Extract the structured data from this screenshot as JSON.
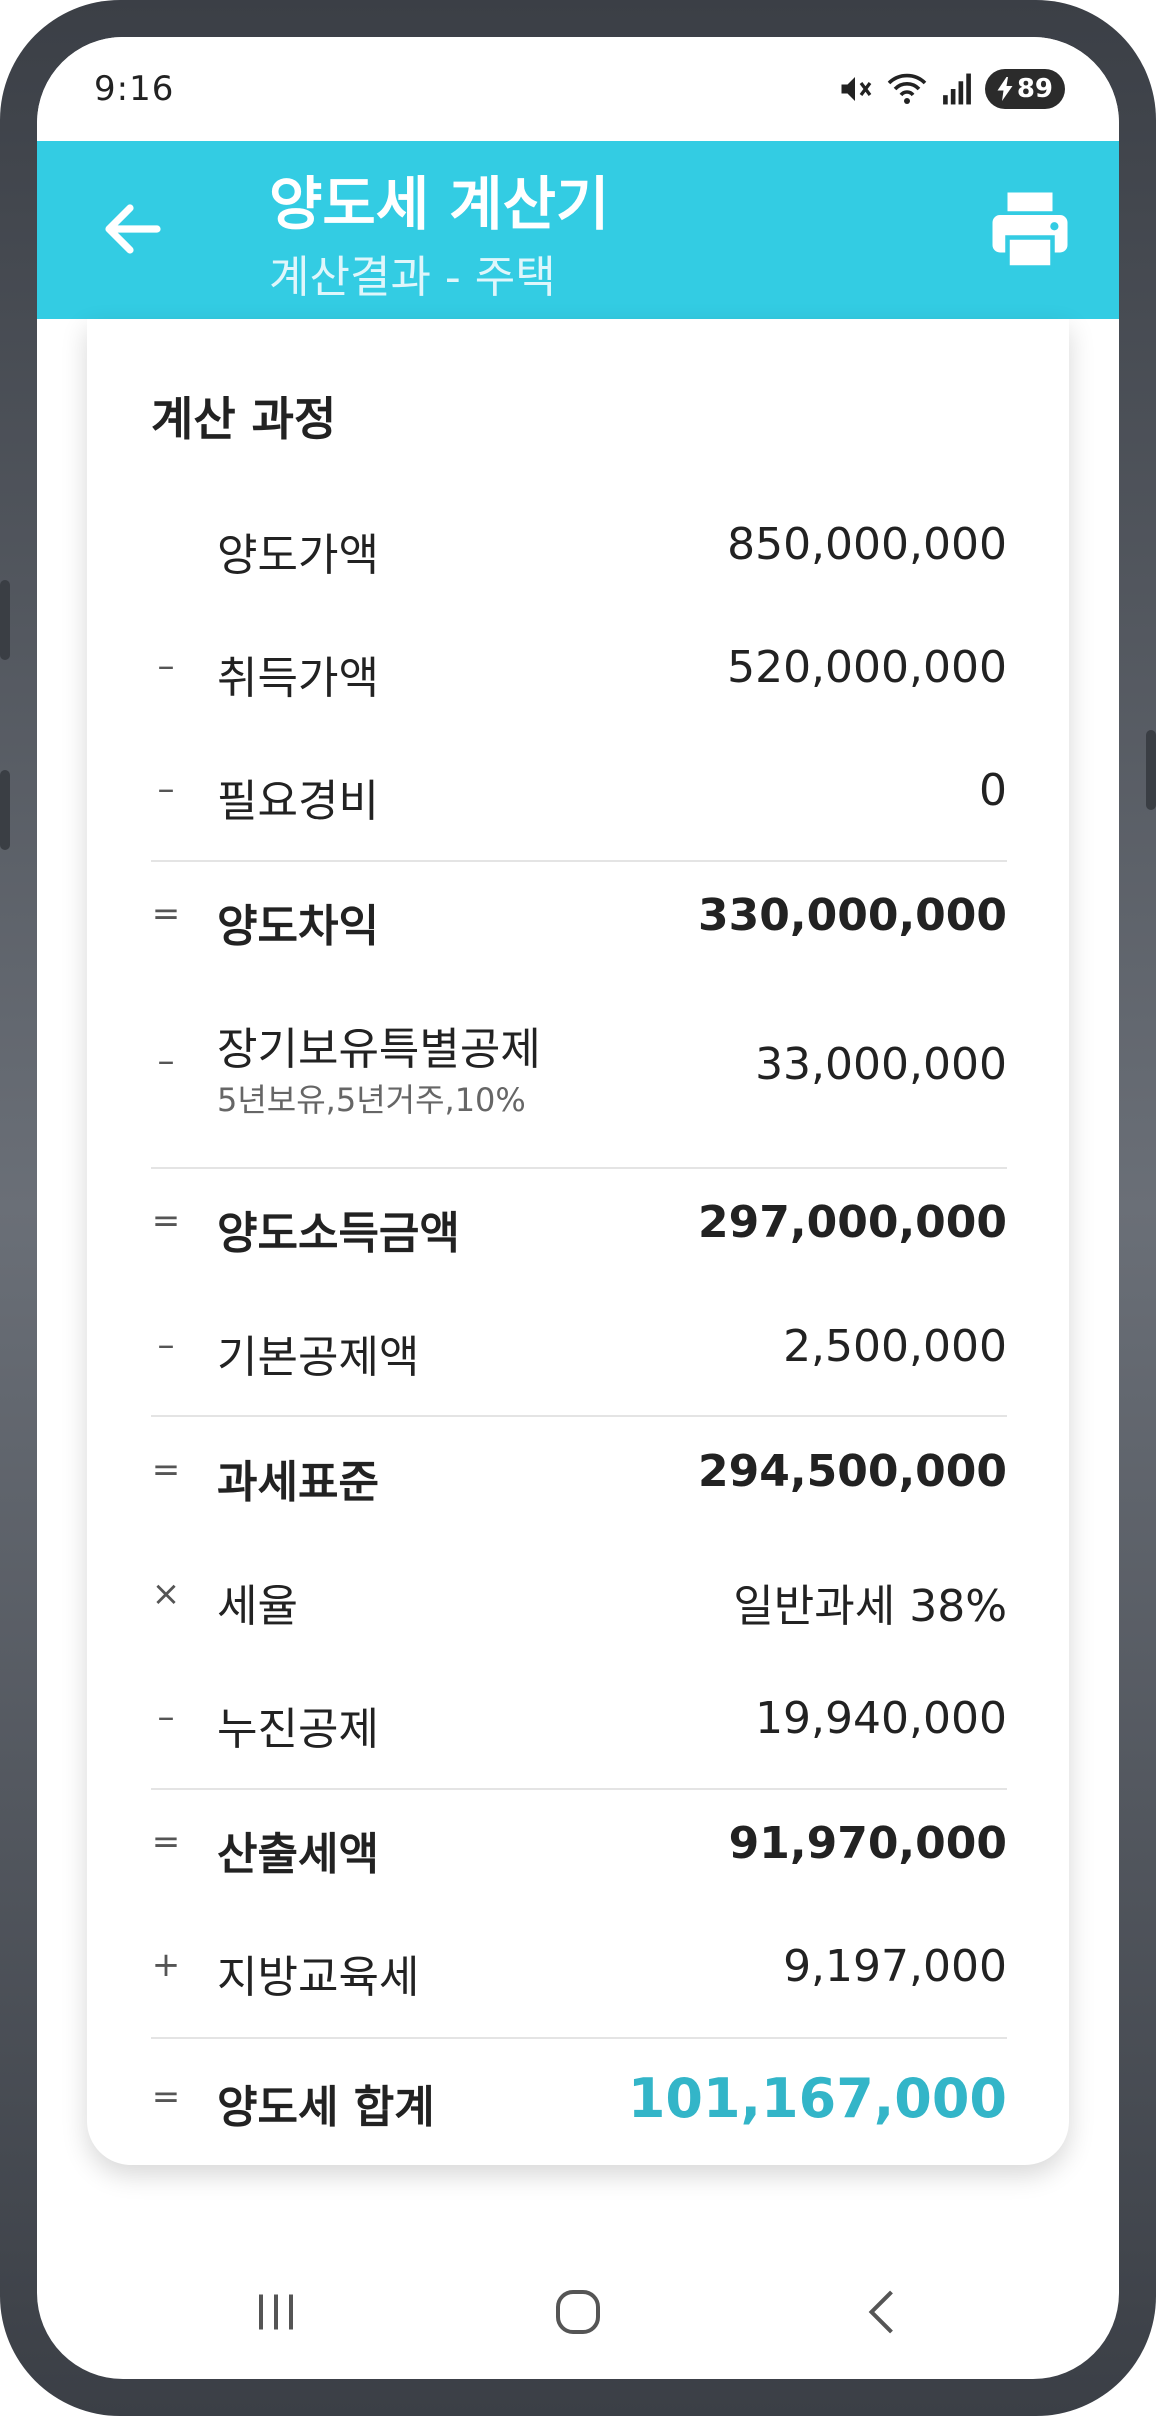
{
  "status_bar": {
    "time": "9:16",
    "battery": "89",
    "icons": [
      "mute-icon",
      "wifi-icon",
      "signal-icon",
      "battery-charging-icon"
    ]
  },
  "app_bar": {
    "title": "양도세 계산기",
    "subtitle": "계산결과 - 주택",
    "color": "#33cce3"
  },
  "card": {
    "title": "계산 과정",
    "rows": [
      {
        "op": "",
        "label": "양도가액",
        "sub": "",
        "value": "850,000,000"
      },
      {
        "op": "–",
        "label": "취득가액",
        "sub": "",
        "value": "520,000,000"
      },
      {
        "op": "–",
        "label": "필요경비",
        "sub": "",
        "value": "0"
      },
      {
        "op": "=",
        "label": "양도차익",
        "sub": "",
        "value": "330,000,000"
      },
      {
        "op": "–",
        "label": "장기보유특별공제",
        "sub": "5년보유,5년거주,10%",
        "value": "33,000,000"
      },
      {
        "op": "=",
        "label": "양도소득금액",
        "sub": "",
        "value": "297,000,000"
      },
      {
        "op": "–",
        "label": "기본공제액",
        "sub": "",
        "value": "2,500,000"
      },
      {
        "op": "=",
        "label": "과세표준",
        "sub": "",
        "value": "294,500,000"
      },
      {
        "op": "×",
        "label": "세율",
        "sub": "",
        "value": "일반과세 38%"
      },
      {
        "op": "–",
        "label": "누진공제",
        "sub": "",
        "value": "19,940,000"
      },
      {
        "op": "=",
        "label": "산출세액",
        "sub": "",
        "value": "91,970,000"
      },
      {
        "op": "+",
        "label": "지방교육세",
        "sub": "",
        "value": "9,197,000"
      },
      {
        "op": "=",
        "label": "양도세 합계",
        "sub": "",
        "value": "101,167,000"
      }
    ],
    "total_color": "#33b5c8"
  },
  "nav_bar": {
    "icons": [
      "recent-apps-icon",
      "home-icon",
      "back-nav-icon"
    ]
  }
}
